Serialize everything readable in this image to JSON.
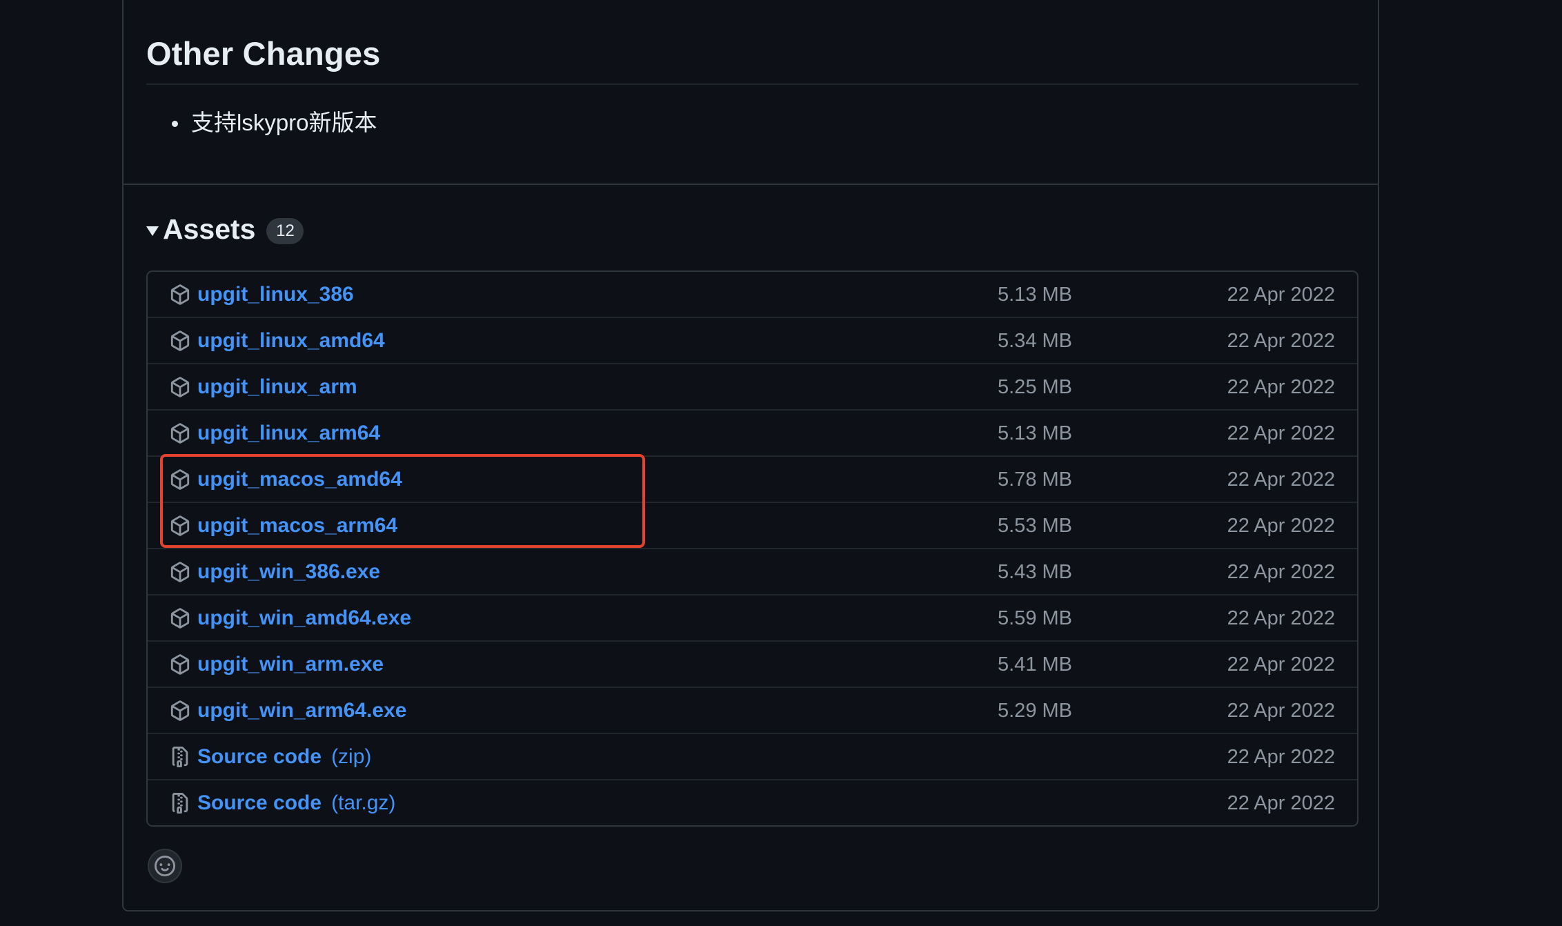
{
  "other_changes": {
    "heading": "Other Changes",
    "items": [
      "支持lskypro新版本"
    ]
  },
  "assets": {
    "title": "Assets",
    "count": "12",
    "rows": [
      {
        "name": "upgit_linux_386",
        "suffix": "",
        "size": "5.13 MB",
        "date": "22 Apr 2022",
        "icon": "package-icon"
      },
      {
        "name": "upgit_linux_amd64",
        "suffix": "",
        "size": "5.34 MB",
        "date": "22 Apr 2022",
        "icon": "package-icon"
      },
      {
        "name": "upgit_linux_arm",
        "suffix": "",
        "size": "5.25 MB",
        "date": "22 Apr 2022",
        "icon": "package-icon"
      },
      {
        "name": "upgit_linux_arm64",
        "suffix": "",
        "size": "5.13 MB",
        "date": "22 Apr 2022",
        "icon": "package-icon"
      },
      {
        "name": "upgit_macos_amd64",
        "suffix": "",
        "size": "5.78 MB",
        "date": "22 Apr 2022",
        "icon": "package-icon"
      },
      {
        "name": "upgit_macos_arm64",
        "suffix": "",
        "size": "5.53 MB",
        "date": "22 Apr 2022",
        "icon": "package-icon"
      },
      {
        "name": "upgit_win_386.exe",
        "suffix": "",
        "size": "5.43 MB",
        "date": "22 Apr 2022",
        "icon": "package-icon"
      },
      {
        "name": "upgit_win_amd64.exe",
        "suffix": "",
        "size": "5.59 MB",
        "date": "22 Apr 2022",
        "icon": "package-icon"
      },
      {
        "name": "upgit_win_arm.exe",
        "suffix": "",
        "size": "5.41 MB",
        "date": "22 Apr 2022",
        "icon": "package-icon"
      },
      {
        "name": "upgit_win_arm64.exe",
        "suffix": "",
        "size": "5.29 MB",
        "date": "22 Apr 2022",
        "icon": "package-icon"
      },
      {
        "name": "Source code",
        "suffix": "(zip)",
        "size": "",
        "date": "22 Apr 2022",
        "icon": "file-zip-icon"
      },
      {
        "name": "Source code",
        "suffix": "(tar.gz)",
        "size": "",
        "date": "22 Apr 2022",
        "icon": "file-zip-icon"
      }
    ]
  },
  "colors": {
    "background": "#0d1117",
    "border": "#30363d",
    "link": "#4493f8",
    "muted": "#8d96a0",
    "highlight": "#e5412f"
  }
}
